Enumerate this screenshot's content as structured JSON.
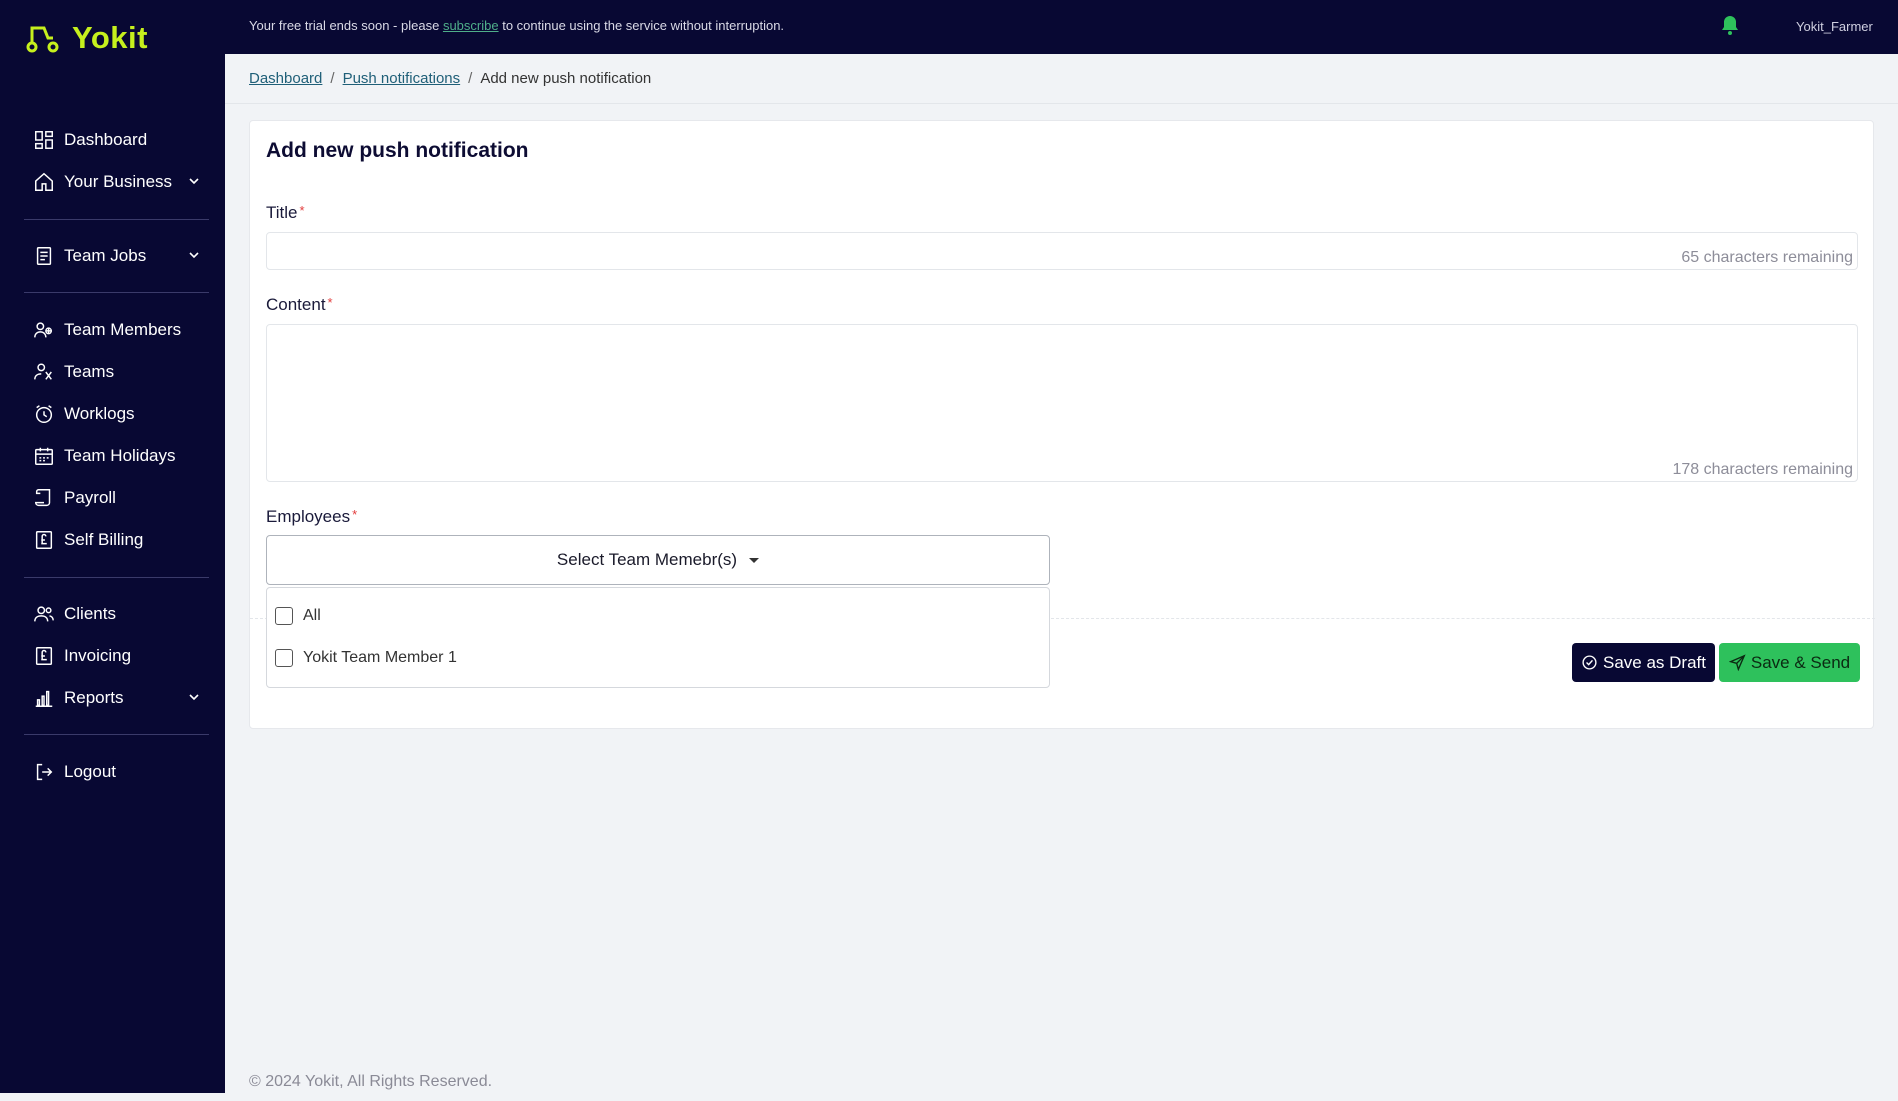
{
  "brand": {
    "name": "Yokit",
    "accent": "#c6f01d",
    "sidebar_bg": "#080833"
  },
  "topbar": {
    "trial_prefix": "Your free trial ends soon - please",
    "trial_link": "subscribe",
    "trial_suffix": "to continue using the service without interruption.",
    "username": "Yokit_Farmer"
  },
  "sidebar": {
    "items": [
      {
        "label": "Dashboard",
        "icon": "dashboard-icon"
      },
      {
        "label": "Your Business",
        "icon": "home-icon"
      },
      {
        "label": "Team Jobs",
        "icon": "jobs-icon"
      },
      {
        "label": "Team Members",
        "icon": "team-members-icon"
      },
      {
        "label": "Teams",
        "icon": "teams-icon"
      },
      {
        "label": "Worklogs",
        "icon": "clock-icon"
      },
      {
        "label": "Team Holidays",
        "icon": "calendar-icon"
      },
      {
        "label": "Payroll",
        "icon": "scroll-icon"
      },
      {
        "label": "Self Billing",
        "icon": "pound-doc-icon"
      },
      {
        "label": "Clients",
        "icon": "clients-icon"
      },
      {
        "label": "Invoicing",
        "icon": "invoice-icon"
      },
      {
        "label": "Reports",
        "icon": "bar-chart-icon"
      },
      {
        "label": "Logout",
        "icon": "logout-icon"
      }
    ]
  },
  "breadcrumb": {
    "items": [
      "Dashboard",
      "Push notifications",
      "Add new push notification"
    ],
    "separator": "/"
  },
  "form": {
    "heading": "Add new push notification",
    "title_label": "Title",
    "title_value": "",
    "title_remaining": "65 characters remaining",
    "content_label": "Content",
    "content_value": "",
    "content_remaining": "178 characters remaining",
    "employees_label": "Employees",
    "required_mark": "*",
    "select_placeholder": "Select Team Memebr(s)",
    "options": [
      "All",
      "Yokit Team Member 1"
    ]
  },
  "actions": {
    "draft_label": "Save as Draft",
    "send_label": "Save & Send",
    "draft_color": "#080833",
    "send_color": "#2ec15c"
  },
  "footer": {
    "text": "© 2024 Yokit, All Rights Reserved."
  }
}
